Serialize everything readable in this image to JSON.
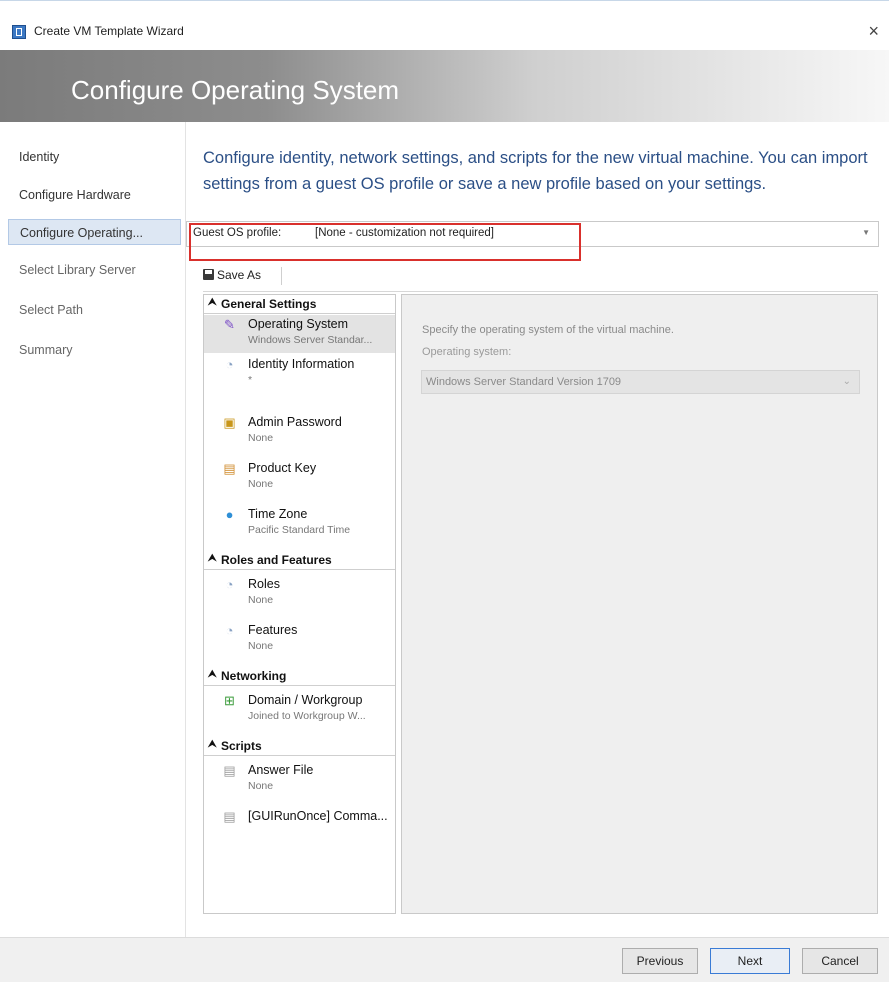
{
  "window": {
    "title": "Create VM Template Wizard",
    "close_glyph": "×"
  },
  "header": {
    "title": "Configure Operating System"
  },
  "nav": {
    "items": [
      {
        "label": "Identity",
        "state": "normal"
      },
      {
        "label": "Configure Hardware",
        "state": "normal"
      },
      {
        "label": "Configure Operating...",
        "state": "active"
      },
      {
        "label": "Select Library Server",
        "state": "dim"
      },
      {
        "label": "Select Path",
        "state": "dim"
      },
      {
        "label": "Summary",
        "state": "dim"
      }
    ]
  },
  "intro": {
    "text": "Configure identity, network settings, and scripts for the new virtual machine. You can import settings from a guest OS profile or save a new profile based on your settings."
  },
  "profile": {
    "label": "Guest OS profile:",
    "value": "[None - customization not required]"
  },
  "toolbar": {
    "save_as_label": "Save As"
  },
  "tree": {
    "groups": [
      {
        "label": "General Settings",
        "items": [
          {
            "name": "Operating System",
            "sub": "Windows Server Standar...",
            "icon": "os-icon",
            "selected": true
          },
          {
            "name": "Identity Information",
            "sub": "*",
            "icon": "identity-icon"
          },
          {
            "name": "Admin Password",
            "sub": "None",
            "icon": "password-icon"
          },
          {
            "name": "Product Key",
            "sub": "None",
            "icon": "product-key-icon"
          },
          {
            "name": "Time Zone",
            "sub": "Pacific Standard Time",
            "icon": "time-zone-icon"
          }
        ]
      },
      {
        "label": "Roles and Features",
        "items": [
          {
            "name": "Roles",
            "sub": "None",
            "icon": "roles-icon"
          },
          {
            "name": "Features",
            "sub": "None",
            "icon": "features-icon"
          }
        ]
      },
      {
        "label": "Networking",
        "items": [
          {
            "name": "Domain / Workgroup",
            "sub": "Joined to Workgroup W...",
            "icon": "domain-icon"
          }
        ]
      },
      {
        "label": "Scripts",
        "items": [
          {
            "name": "Answer File",
            "sub": "None",
            "icon": "answer-file-icon"
          },
          {
            "name": "[GUIRunOnce] Comma...",
            "sub": "",
            "icon": "script-icon"
          }
        ]
      }
    ]
  },
  "detail": {
    "description": "Specify the operating system of the virtual machine.",
    "os_label": "Operating system:",
    "os_value": "Windows Server Standard Version 1709"
  },
  "buttons": {
    "previous": "Previous",
    "next": "Next",
    "cancel": "Cancel"
  },
  "colors": {
    "accent": "#2b4f86",
    "highlight_border": "#d9302c",
    "selection": "#dde7f3"
  }
}
